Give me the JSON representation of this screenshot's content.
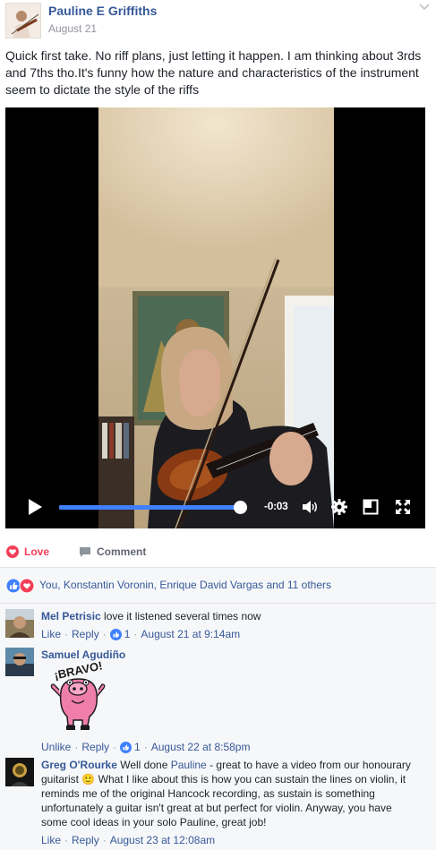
{
  "post": {
    "author": "Pauline E Griffiths",
    "date": "August 21",
    "text": "Quick first take. No riff plans, just letting it happen. I am thinking about 3rds and 7ths tho.It's funny how the nature and characteristics of the instrument seem to dictate the style of the riffs"
  },
  "video": {
    "time_remaining": "-0:03",
    "progress": 0.99
  },
  "actions": {
    "love_label": "Love",
    "comment_label": "Comment"
  },
  "reactions": {
    "names": "You, Konstantin Voronin, Enrique David Vargas and 11 others"
  },
  "comments": [
    {
      "author": "Mel Petrisic",
      "text": "love it listened several times now",
      "like_label": "Like",
      "reply_label": "Reply",
      "likes": "1",
      "time": "August 21 at 9:14am"
    },
    {
      "author": "Samuel Agudiño",
      "sticker_text": "¡BRAVO!",
      "like_label": "Unlike",
      "reply_label": "Reply",
      "likes": "1",
      "time": "August 22 at 8:58pm"
    },
    {
      "author": "Greg O'Rourke",
      "text_before": "Well done ",
      "mention": "Pauline",
      "text_after": " - great to have a video from our honourary guitarist 🙂 What I like about this is how you can sustain the lines on violin, it reminds me of the original Hancock recording, as sustain is something unfortunately a guitar isn't great at but perfect for violin. Anyway, you have some cool ideas in your solo Pauline, great job!",
      "like_label": "Like",
      "reply_label": "Reply",
      "time": "August 23 at 12:08am"
    }
  ],
  "colors": {
    "link": "#365899",
    "love": "#f33e58",
    "progress": "#4080ff",
    "meta": "#90949c"
  }
}
